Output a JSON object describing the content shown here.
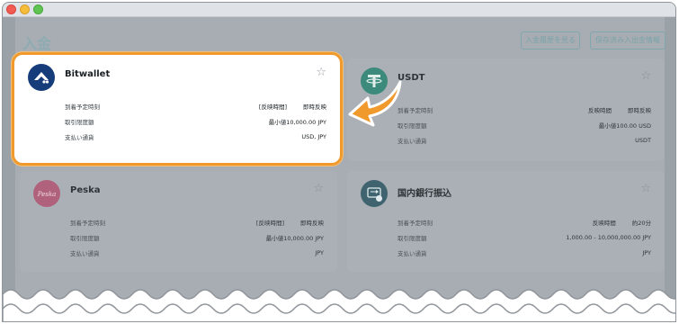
{
  "page": {
    "title": "入金",
    "history_button": "入金履歴を見る",
    "saved_button": "保存済み入出金情報"
  },
  "methods": [
    {
      "name": "Bitwallet",
      "icon": "bitwallet-logo",
      "highlighted": true,
      "rows": [
        {
          "label": "到着予定時刻",
          "values": [
            "[反映時間]",
            "即時反映"
          ]
        },
        {
          "label": "取引限度額",
          "values": [
            "最小値10,000.00 JPY"
          ]
        },
        {
          "label": "支払い通貨",
          "values": [
            "USD, JPY"
          ]
        }
      ]
    },
    {
      "name": "USDT",
      "icon": "tether-logo",
      "highlighted": false,
      "rows": [
        {
          "label": "到着予定時刻",
          "values": [
            "反映時間",
            "即時反映"
          ]
        },
        {
          "label": "取引限度額",
          "values": [
            "最小値100.00 USD"
          ]
        },
        {
          "label": "支払い通貨",
          "values": [
            "USDT"
          ]
        }
      ]
    },
    {
      "name": "Peska",
      "icon": "peska-logo",
      "highlighted": false,
      "rows": [
        {
          "label": "到着予定時刻",
          "values": [
            "[反映時間]",
            "即時反映"
          ]
        },
        {
          "label": "取引限度額",
          "values": [
            "最小値10,000.00 JPY"
          ]
        },
        {
          "label": "支払い通貨",
          "values": [
            "JPY"
          ]
        }
      ]
    },
    {
      "name": "国内銀行振込",
      "icon": "bank-transfer-logo",
      "highlighted": false,
      "rows": [
        {
          "label": "到着予定時刻",
          "values": [
            "反映時間",
            "約20分"
          ]
        },
        {
          "label": "取引限度額",
          "values": [
            "1,000.00 - 10,000,000.00 JPY"
          ]
        },
        {
          "label": "支払い通貨",
          "values": [
            "JPY"
          ]
        }
      ]
    }
  ],
  "colors": {
    "highlight_border": "#f09a2d",
    "arrow": "#f09a2d",
    "title_teal": "#8eabb2"
  }
}
